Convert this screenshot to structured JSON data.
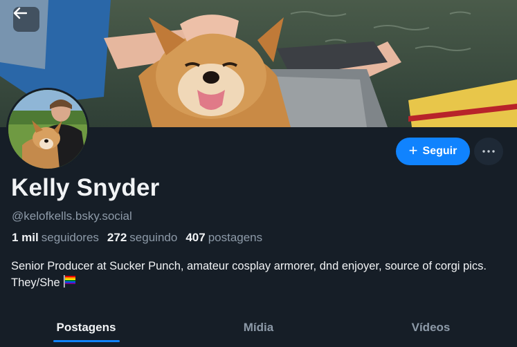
{
  "profile": {
    "display_name": "Kelly Snyder",
    "handle": "@kelofkells.bsky.social",
    "bio": "Senior Producer at Sucker Punch, amateur cosplay armorer, dnd enjoyer, source of corgi pics. They/She"
  },
  "stats": {
    "followers_count": "1 mil",
    "followers_label": "seguidores",
    "following_count": "272",
    "following_label": "seguindo",
    "posts_count": "407",
    "posts_label": "postagens"
  },
  "actions": {
    "follow_label": "Seguir",
    "more_icon": "ellipsis-icon",
    "back_icon": "arrow-left-icon"
  },
  "tabs": [
    {
      "label": "Postagens",
      "active": true
    },
    {
      "label": "Mídia",
      "active": false
    },
    {
      "label": "Vídeos",
      "active": false
    }
  ],
  "colors": {
    "background": "#161e27",
    "accent": "#1083fe",
    "muted_text": "#8d9aa8"
  }
}
